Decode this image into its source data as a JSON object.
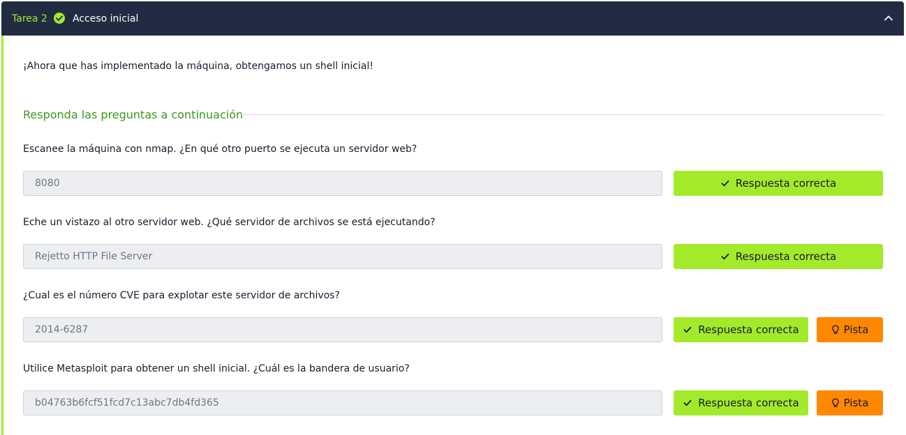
{
  "task": {
    "number_label": "Tarea 2",
    "title": "Acceso inicial",
    "status_icon": "check-circle-icon",
    "collapse_icon": "chevron-up-icon"
  },
  "intro": "¡Ahora que has implementado la máquina, obtengamos un shell inicial!",
  "section_title": "Responda las preguntas a continuación",
  "questions": [
    {
      "text": "Escanee la máquina con nmap. ¿En qué otro puerto se ejecuta un servidor web?",
      "answer": "8080",
      "button_label": "Respuesta correcta"
    },
    {
      "text": "Eche un vistazo al otro servidor web. ¿Qué servidor de archivos se está ejecutando?",
      "answer": "Rejetto HTTP File Server",
      "button_label": "Respuesta correcta"
    },
    {
      "text": "¿Cual es el número CVE para explotar este servidor de archivos?",
      "answer": "2014-6287",
      "button_label": "Respuesta correcta",
      "hint_label": "Pista"
    },
    {
      "text": "Utilice Metasploit para obtener un shell inicial. ¿Cuál es la bandera de usuario?",
      "answer": "b04763b6fcf51fcd7c13abc7db4fd365",
      "button_label": "Respuesta correcta",
      "hint_label": "Pista"
    }
  ],
  "colors": {
    "header_bg": "#212c42",
    "accent_green": "#a3ea2a",
    "section_green": "#3a9a1a",
    "hint_orange": "#ff8800"
  }
}
